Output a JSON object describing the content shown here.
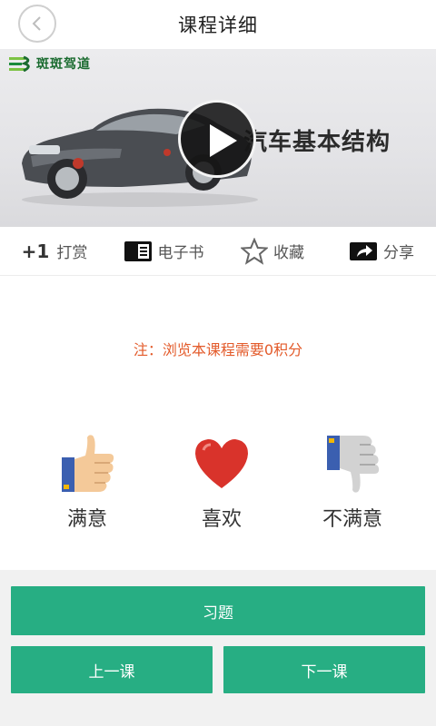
{
  "header": {
    "title": "课程详细",
    "back_icon": "chevron-left-icon"
  },
  "video": {
    "logo_text": "斑斑驾道",
    "caption": "汽车基本结构",
    "play_icon": "play-icon"
  },
  "actions": [
    {
      "prefix": "+1",
      "label": "打赏",
      "icon": "plus-one"
    },
    {
      "label": "电子书",
      "icon": "ebook-icon"
    },
    {
      "label": "收藏",
      "icon": "star-icon"
    },
    {
      "label": "分享",
      "icon": "share-icon"
    }
  ],
  "note": "注：浏览本课程需要0积分",
  "ratings": [
    {
      "label": "满意",
      "icon": "thumbs-up-icon"
    },
    {
      "label": "喜欢",
      "icon": "heart-icon"
    },
    {
      "label": "不满意",
      "icon": "thumbs-down-icon"
    }
  ],
  "buttons": {
    "exercise": "习题",
    "prev": "上一课",
    "next": "下一课"
  },
  "colors": {
    "accent": "#27ae83",
    "note": "#e35b2b",
    "heart": "#d9332b"
  }
}
